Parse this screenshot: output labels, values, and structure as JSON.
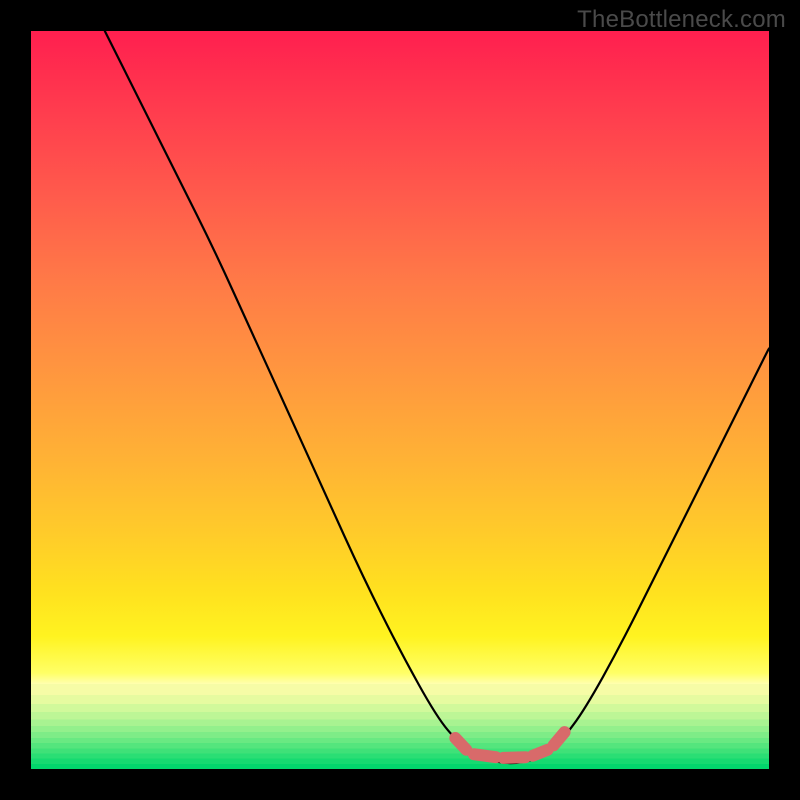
{
  "watermark": "TheBottleneck.com",
  "chart_data": {
    "type": "line",
    "title": "",
    "xlabel": "",
    "ylabel": "",
    "xlim": [
      0,
      100
    ],
    "ylim": [
      0,
      100
    ],
    "series": [
      {
        "name": "curve",
        "x": [
          10,
          15,
          20,
          25,
          30,
          35,
          40,
          45,
          50,
          55,
          58,
          60,
          62,
          64,
          66,
          68,
          70,
          72,
          75,
          80,
          85,
          90,
          95,
          100
        ],
        "y": [
          100,
          90,
          80,
          70,
          59,
          48,
          37,
          26,
          16,
          7,
          3.5,
          2,
          1.2,
          0.8,
          0.8,
          1.2,
          2.2,
          4,
          8,
          17,
          27,
          37,
          47,
          57
        ]
      }
    ],
    "markers": {
      "name": "flat-bottom-dashes",
      "color": "#d86a6a",
      "segments": [
        {
          "x0": 57.5,
          "y0": 4.2,
          "x1": 59.0,
          "y1": 2.6
        },
        {
          "x0": 60.0,
          "y0": 2.0,
          "x1": 63.0,
          "y1": 1.6
        },
        {
          "x0": 64.0,
          "y0": 1.5,
          "x1": 67.0,
          "y1": 1.6
        },
        {
          "x0": 68.0,
          "y0": 1.8,
          "x1": 70.0,
          "y1": 2.6
        },
        {
          "x0": 70.8,
          "y0": 3.2,
          "x1": 72.3,
          "y1": 5.0
        }
      ]
    },
    "gradient_stops": {
      "main": [
        {
          "pct": 0,
          "color": "#ff1f4f"
        },
        {
          "pct": 34,
          "color": "#ff7a47"
        },
        {
          "pct": 68,
          "color": "#ffcb2a"
        },
        {
          "pct": 87,
          "color": "#ffff66"
        },
        {
          "pct": 88.5,
          "color": "#ffffb0"
        }
      ],
      "green_bands_start_pct": 88.5,
      "green_bands_end_color": "#02d66c"
    }
  }
}
